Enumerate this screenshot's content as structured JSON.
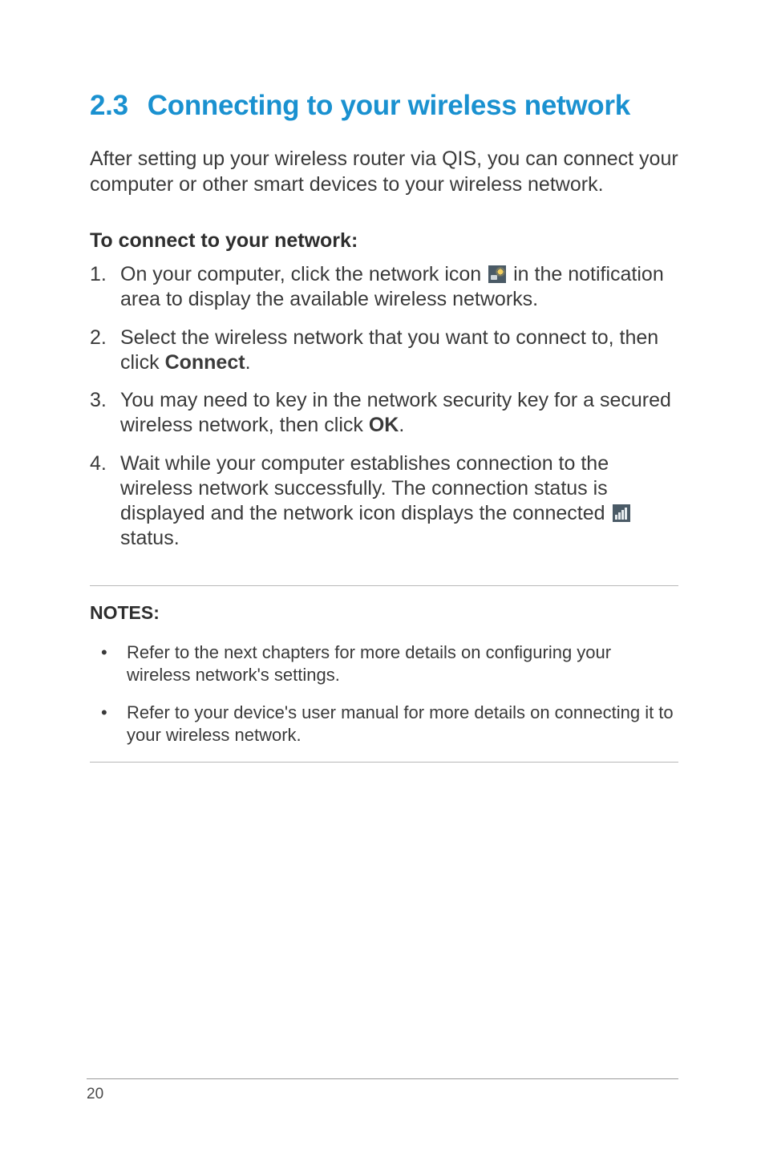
{
  "heading": {
    "number": "2.3",
    "title": "Connecting to your wireless network"
  },
  "intro": "After setting up your wireless router via QIS, you can connect your computer or other smart devices to your wireless network.",
  "sub_heading": "To connect to your network:",
  "steps": [
    {
      "pre": "On your computer, click the network icon ",
      "icon": "network-icon",
      "post": " in the notification area to display the available wireless networks."
    },
    {
      "pre": "Select the wireless network that you want to connect to, then click ",
      "bold": "Connect",
      "post": "."
    },
    {
      "pre": "You may need to key in the network security key for a secured wireless network, then click ",
      "bold": "OK",
      "post": "."
    },
    {
      "pre": "Wait while your computer establishes connection to the wireless network successfully. The connection status is displayed and the network icon displays the connected ",
      "icon": "connected-icon",
      "post": " status."
    }
  ],
  "notes": {
    "title": "NOTES:",
    "items": [
      "Refer to the next chapters for more details on configuring your wireless network's settings.",
      "Refer to your device's user manual for more details on connecting it to your wireless network."
    ]
  },
  "page_number": "20"
}
